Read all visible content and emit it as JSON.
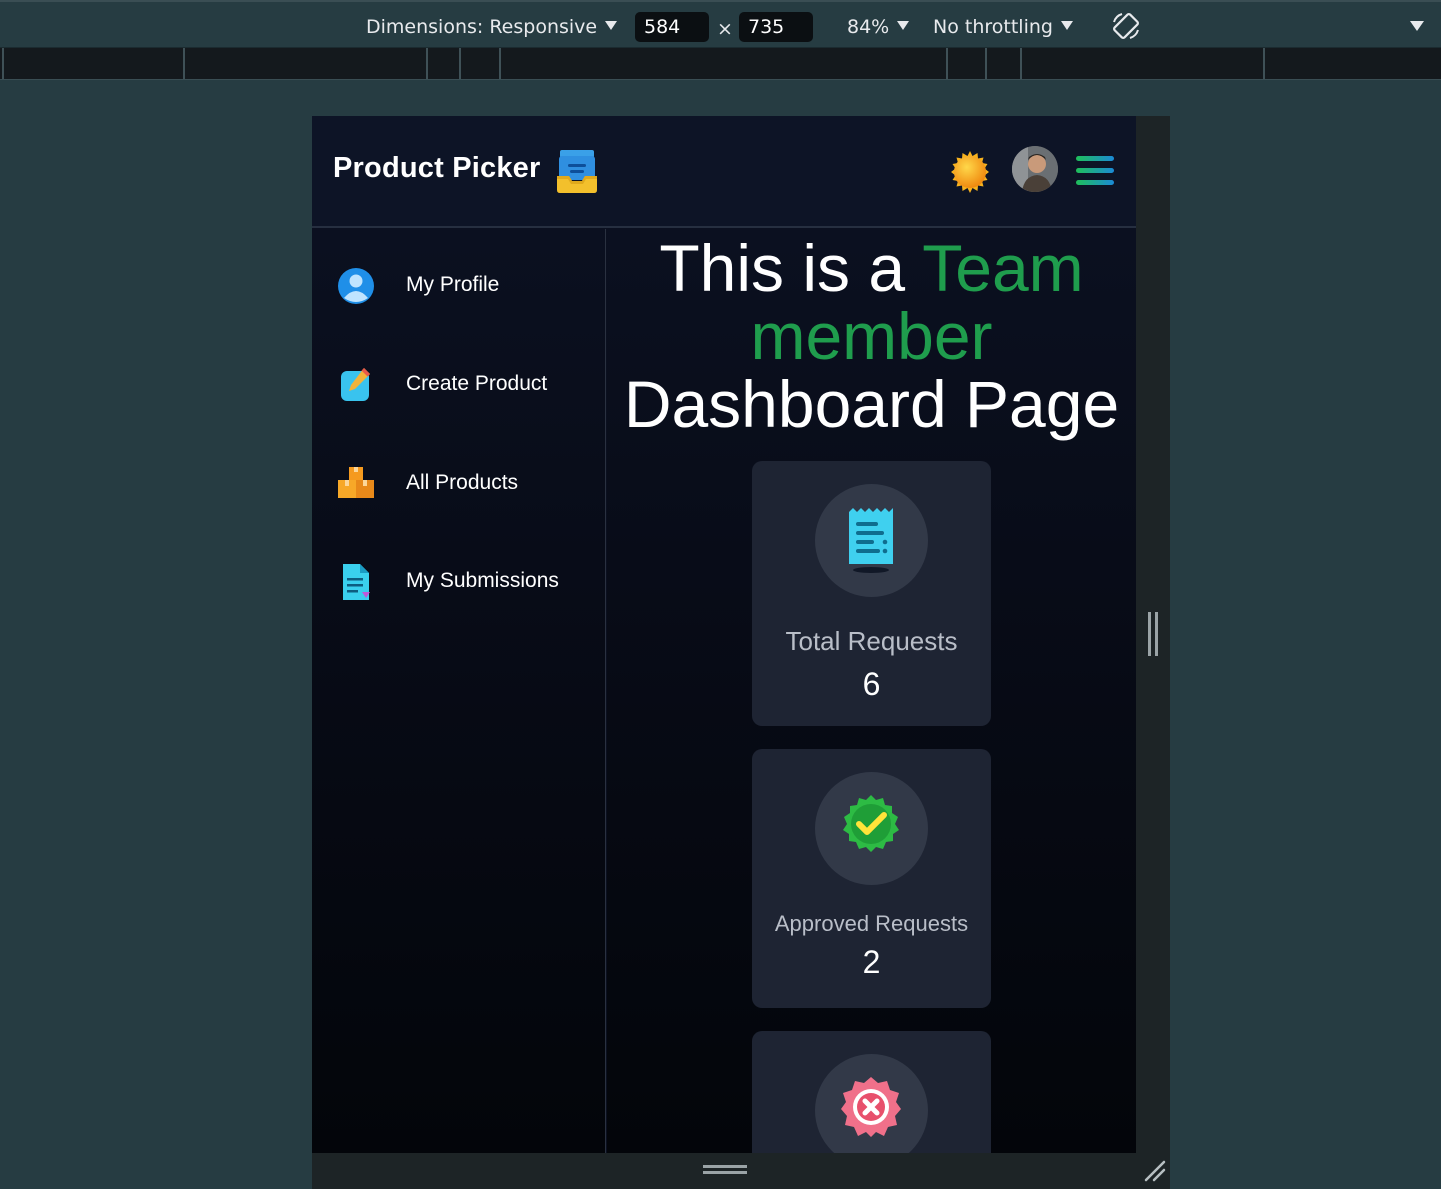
{
  "devtools": {
    "dimensions_label": "Dimensions: Responsive",
    "width": "584",
    "times": "×",
    "height": "735",
    "zoom": "84%",
    "throttling": "No throttling"
  },
  "app": {
    "brand": "Product Picker",
    "icons": {
      "brand": "inbox-tray-icon",
      "theme": "sun-icon",
      "avatar": "user-avatar",
      "menu": "hamburger-menu-icon"
    }
  },
  "sidebar": {
    "items": [
      {
        "label": "My Profile",
        "icon": "user-profile-icon"
      },
      {
        "label": "Create Product",
        "icon": "pencil-note-icon"
      },
      {
        "label": "All Products",
        "icon": "boxes-icon"
      },
      {
        "label": "My Submissions",
        "icon": "document-icon"
      }
    ]
  },
  "heading": {
    "part1": "This is a ",
    "highlight1": "Team",
    "highlight2": "member",
    "part2": "Dashboard Page"
  },
  "cards": [
    {
      "title": "Total Requests",
      "value": "6",
      "icon": "receipt-icon"
    },
    {
      "title": "Approved Requests",
      "value": "2",
      "icon": "approved-badge-icon"
    },
    {
      "title": "",
      "value": "",
      "icon": "rejected-badge-icon"
    }
  ],
  "colors": {
    "accent_green": "#1f9d4d",
    "navbar_bg": "#0d1426",
    "card_bg": "#1e2433"
  }
}
